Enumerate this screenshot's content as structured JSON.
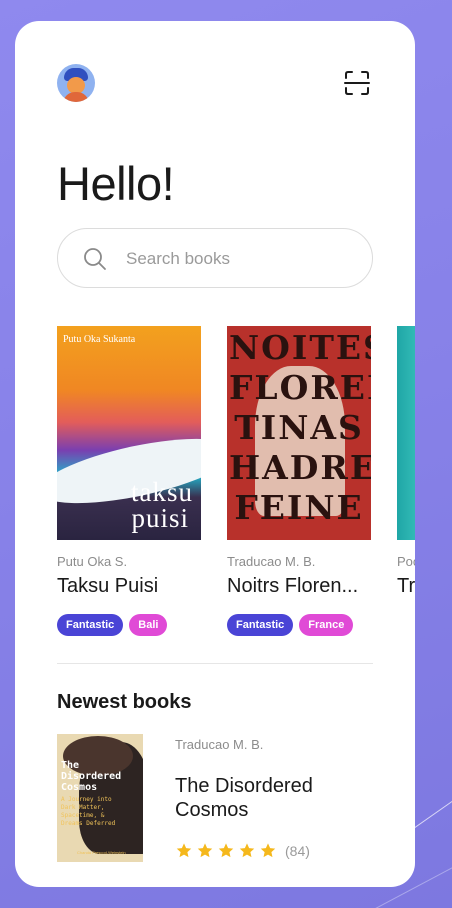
{
  "header": {
    "avatar_icon": "user-avatar",
    "scan_icon": "scan-icon",
    "greeting": "Hello!"
  },
  "search": {
    "placeholder": "Search books",
    "icon": "search-icon"
  },
  "featured_books": [
    {
      "author": "Putu Oka S.",
      "title": "Taksu Puisi",
      "cover_author": "Putu Oka Sukanta",
      "cover_title_line1": "taksu",
      "cover_title_line2": "puisi",
      "tags": [
        "Fantastic",
        "Bali"
      ]
    },
    {
      "author": "Traducao M. B.",
      "title": "Noitrs Floren...",
      "cover_lettering": "NOITES FLOREN TINAS HADRE FEINE",
      "tags": [
        "Fantastic",
        "France"
      ]
    },
    {
      "author": "Poc",
      "title": "Tr"
    }
  ],
  "newest": {
    "section_title": "Newest books",
    "author": "Traducao M. B.",
    "title": "The Disordered Cosmos",
    "cover_title": "The Disordered Cosmos",
    "cover_subtitle": "A Journey into Dark Matter, Spacetime, & Dreams Deferred",
    "cover_author": "Chanda Prescod-Weinstein",
    "rating": 5,
    "review_count": "(84)"
  },
  "colors": {
    "background": "#8a84ea",
    "tag_blue": "#4a44d6",
    "tag_pink": "#e04ad6",
    "star": "#f5b81c"
  }
}
